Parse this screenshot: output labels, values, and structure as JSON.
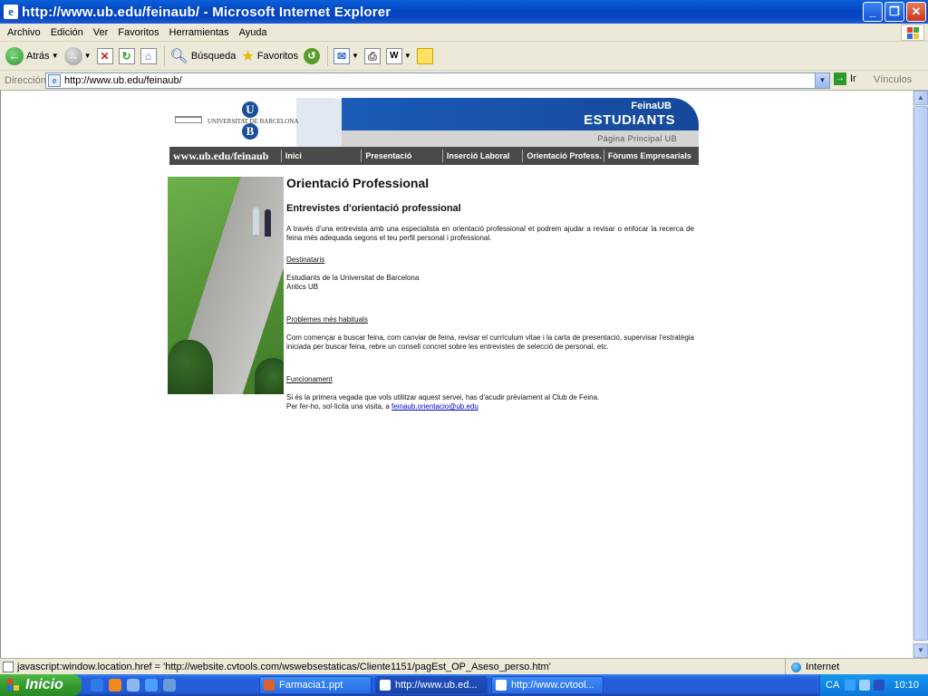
{
  "window": {
    "title": "http://www.ub.edu/feinaub/ - Microsoft Internet Explorer",
    "min_glyph": "_",
    "max_glyph": "❐",
    "close_glyph": "✕"
  },
  "menu": [
    "Archivo",
    "Edición",
    "Ver",
    "Favoritos",
    "Herramientas",
    "Ayuda"
  ],
  "toolbar": {
    "back_label": "Atrás",
    "search_label": "Búsqueda",
    "favorites_label": "Favoritos"
  },
  "address": {
    "label": "Dirección",
    "url": "http://www.ub.edu/feinaub/",
    "go_label": "Ir",
    "links_label": "Vínculos"
  },
  "page": {
    "banner": {
      "uni_name": "UNIVERSITAT DE BARCELONA",
      "logo_u": "U",
      "logo_b": "B",
      "feina": "FeinaUB",
      "estudiants": "ESTUDIANTS",
      "pagina_principal": "Pàgina Principal UB"
    },
    "nav": {
      "site": "www.ub.edu/feinaub",
      "items": [
        "Inici",
        "Presentació",
        "Inserció Laboral",
        "Orientació Profess.",
        "Fòrums Empresarials"
      ]
    },
    "content": {
      "title": "Orientació Professional",
      "subtitle": "Entrevistes d'orientació professional",
      "intro": "A través d'una entrevista amb una especialista en orientació professional et podrem ajudar a revisar o enfocar la recerca de feina més adequada segons el teu perfil personal i professional.",
      "dest_title": "Destinataris",
      "dest_line1": "Estudiants de la Universitat de Barcelona",
      "dest_line2": "Antics UB",
      "prob_title": "Problemes més habituals",
      "prob_text": "Com començar a buscar feina, com canviar de feina, revisar el currículum vitae i la carta de presentació, supervisar l'estratègia iniciada per buscar feina, rebre un consell concret sobre les entrevistes de selecció de personal, etc.",
      "func_title": "Funcionament",
      "func_line1": "Si és la primera vegada que vols utilitzar aquest servei, has d'acudir prèviament al Club de Feina.",
      "func_line2_prefix": "Per fer-ho, sol·licita una visita, a ",
      "func_email": "feinaub.orientacio@ub.edu"
    }
  },
  "status": {
    "text": "javascript:window.location.href = 'http://website.cvtools.com/wswebsestaticas/Cliente1151/pagEst_OP_Aseso_perso.htm'",
    "zone": "Internet"
  },
  "taskbar": {
    "start": "Inicio",
    "tasks": [
      "Farmacia1.ppt",
      "http://www.ub.ed...",
      "http://www.cvtool..."
    ],
    "tray_text": "CA",
    "clock": "10:10"
  },
  "colors": {
    "xp_blue": "#0446c2",
    "ub_blue": "#1a5cb8",
    "nav_grey": "#4a4a4a",
    "link": "#0000cc"
  }
}
